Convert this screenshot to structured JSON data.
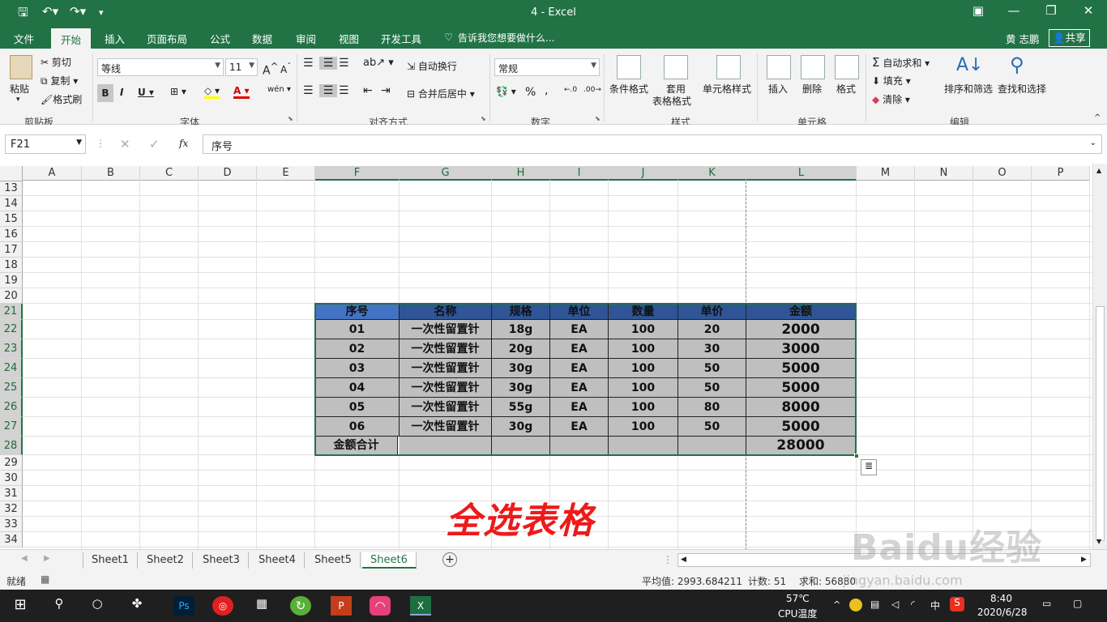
{
  "window": {
    "title": "4 - Excel",
    "user": "黄 志鹏",
    "share": "共享"
  },
  "tabs": [
    "文件",
    "开始",
    "插入",
    "页面布局",
    "公式",
    "数据",
    "审阅",
    "视图",
    "开发工具"
  ],
  "tell_me": "告诉我您想要做什么...",
  "ribbon": {
    "paste": "粘贴",
    "cut": "剪切",
    "copy": "复制",
    "format_painter": "格式刷",
    "clipboard": "剪贴板",
    "font_name": "等线",
    "font_size": "11",
    "font_group": "字体",
    "wrap": "自动换行",
    "merge": "合并后居中",
    "align_group": "对齐方式",
    "number_format": "常规",
    "number_group": "数字",
    "cond_format": "条件格式",
    "table_format": "套用\n表格格式",
    "table_format_1": "套用",
    "table_format_2": "表格格式",
    "cell_style": "单元格样式",
    "style_group": "样式",
    "insert": "插入",
    "delete": "删除",
    "format": "格式",
    "cells_group": "单元格",
    "autosum": "自动求和",
    "fill": "填充",
    "clear": "清除",
    "sort": "排序和筛选",
    "find": "查找和选择",
    "edit_group": "编辑"
  },
  "formula_bar": {
    "name_box": "F21",
    "fx": "fx",
    "content": "序号"
  },
  "columns": [
    "A",
    "B",
    "C",
    "D",
    "E",
    "F",
    "G",
    "H",
    "I",
    "J",
    "K",
    "L",
    "M",
    "N",
    "O",
    "P"
  ],
  "rows": [
    "13",
    "14",
    "15",
    "16",
    "17",
    "18",
    "19",
    "20",
    "21",
    "22",
    "23",
    "24",
    "25",
    "26",
    "27",
    "28",
    "29",
    "30",
    "31",
    "32",
    "33",
    "34"
  ],
  "table": {
    "headers": [
      "序号",
      "名称",
      "规格",
      "单位",
      "数量",
      "单价",
      "金额"
    ],
    "rows": [
      [
        "01",
        "一次性留置针",
        "18g",
        "EA",
        "100",
        "20",
        "2000"
      ],
      [
        "02",
        "一次性留置针",
        "20g",
        "EA",
        "100",
        "30",
        "3000"
      ],
      [
        "03",
        "一次性留置针",
        "30g",
        "EA",
        "100",
        "50",
        "5000"
      ],
      [
        "04",
        "一次性留置针",
        "30g",
        "EA",
        "100",
        "50",
        "5000"
      ],
      [
        "05",
        "一次性留置针",
        "55g",
        "EA",
        "100",
        "80",
        "8000"
      ],
      [
        "06",
        "一次性留置针",
        "30g",
        "EA",
        "100",
        "50",
        "5000"
      ]
    ],
    "total_label": "金额合计",
    "total_value": "28000"
  },
  "annotation": "全选表格",
  "sheets": [
    "Sheet1",
    "Sheet2",
    "Sheet3",
    "Sheet4",
    "Sheet5",
    "Sheet6"
  ],
  "status": {
    "mode": "就绪",
    "average": "平均值: 2993.684211",
    "count": "计数: 51",
    "sum": "求和: 56880"
  },
  "taskbar": {
    "temp": "57℃",
    "temp_label": "CPU温度",
    "ime": "中",
    "time": "8:40",
    "date": "2020/6/28"
  },
  "watermark": "Baidu经验",
  "watermark_url": "jingyan.baidu.com"
}
